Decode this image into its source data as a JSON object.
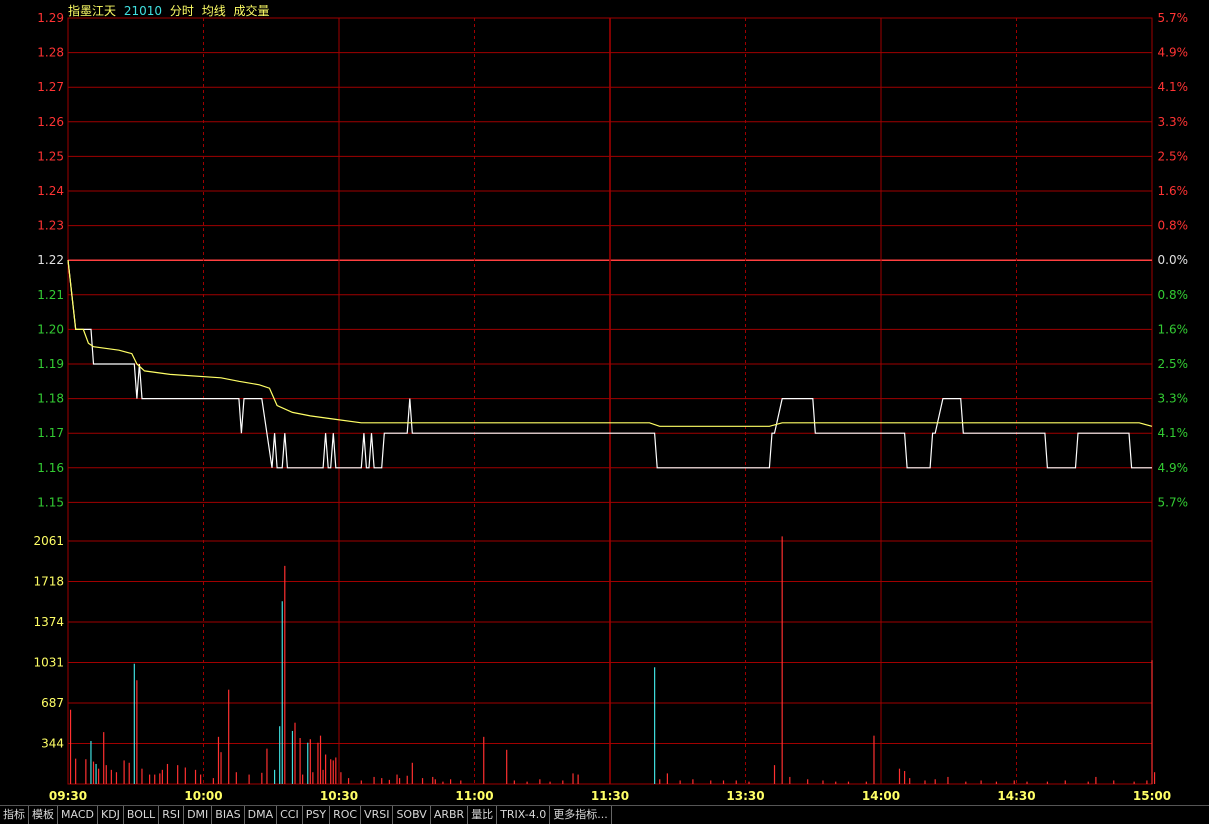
{
  "legend": {
    "name": "指墨江天",
    "code": "21010",
    "tabs": [
      "分时",
      "均线",
      "成交量"
    ]
  },
  "colors": {
    "grid": "#a00000",
    "up": "#ff3333",
    "down": "#33cc33",
    "neutral": "#e0e0e0",
    "price_line": "#ffffff",
    "avg_line": "#ffff66",
    "vol_up": "#ff3030",
    "vol_down": "#40e0e0",
    "volume_label": "#ffff66",
    "legend_name": "#ffff66",
    "legend_code": "#40e0e0",
    "legend_tabs": "#ffff66",
    "time_label": "#ffff66"
  },
  "indicator_tabs": [
    "指标",
    "模板",
    "MACD",
    "KDJ",
    "BOLL",
    "RSI",
    "DMI",
    "BIAS",
    "DMA",
    "CCI",
    "PSY",
    "ROC",
    "VRSI",
    "SOBV",
    "ARBR",
    "量比",
    "TRIX-4.0",
    "更多指标..."
  ],
  "chart_data": {
    "type": "line",
    "prev_close": 1.22,
    "price_axis": {
      "ticks": [
        "1.29",
        "1.28",
        "1.27",
        "1.26",
        "1.25",
        "1.24",
        "1.23",
        "1.22",
        "1.21",
        "1.20",
        "1.19",
        "1.18",
        "1.17",
        "1.16",
        "1.15"
      ],
      "ylim": [
        1.15,
        1.29
      ]
    },
    "pct_axis": {
      "ticks": [
        "5.7%",
        "4.9%",
        "4.1%",
        "3.3%",
        "2.5%",
        "1.6%",
        "0.8%",
        "0.0%",
        "0.8%",
        "1.6%",
        "2.5%",
        "3.3%",
        "4.1%",
        "4.9%",
        "5.7%"
      ]
    },
    "volume_axis": {
      "ticks": [
        "2061",
        "1718",
        "1374",
        "1031",
        "687",
        "344"
      ],
      "ylim": [
        0,
        2400
      ]
    },
    "time_axis": {
      "labels": [
        "09:30",
        "10:00",
        "10:30",
        "11:00",
        "11:30",
        "13:30",
        "14:00",
        "14:30",
        "15:00"
      ],
      "total_minutes": 240
    },
    "series": [
      {
        "name": "分时",
        "points": [
          [
            0,
            1.22
          ],
          [
            3,
            1.2
          ],
          [
            9,
            1.2
          ],
          [
            10,
            1.19
          ],
          [
            26,
            1.19
          ],
          [
            27,
            1.18
          ],
          [
            28,
            1.19
          ],
          [
            29,
            1.18
          ],
          [
            67,
            1.18
          ],
          [
            68,
            1.17
          ],
          [
            69,
            1.18
          ],
          [
            76,
            1.18
          ],
          [
            80,
            1.16
          ],
          [
            81,
            1.17
          ],
          [
            82,
            1.16
          ],
          [
            84,
            1.16
          ],
          [
            85,
            1.17
          ],
          [
            86,
            1.16
          ],
          [
            100,
            1.16
          ],
          [
            101,
            1.17
          ],
          [
            102,
            1.16
          ],
          [
            103,
            1.16
          ],
          [
            104,
            1.17
          ],
          [
            105,
            1.16
          ],
          [
            115,
            1.16
          ],
          [
            116,
            1.17
          ],
          [
            117,
            1.16
          ],
          [
            118,
            1.16
          ],
          [
            119,
            1.17
          ],
          [
            120,
            1.16
          ],
          [
            123,
            1.16
          ],
          [
            124,
            1.17
          ],
          [
            133,
            1.17
          ],
          [
            134,
            1.18
          ],
          [
            135,
            1.17
          ],
          [
            230,
            1.17
          ],
          [
            231,
            1.16
          ],
          [
            275,
            1.16
          ],
          [
            276,
            1.17
          ],
          [
            277,
            1.17
          ],
          [
            280,
            1.18
          ],
          [
            292,
            1.18
          ],
          [
            293,
            1.17
          ],
          [
            328,
            1.17
          ],
          [
            329,
            1.16
          ],
          [
            338,
            1.16
          ],
          [
            339,
            1.17
          ],
          [
            340,
            1.17
          ],
          [
            343,
            1.18
          ],
          [
            350,
            1.18
          ],
          [
            351,
            1.17
          ],
          [
            383,
            1.17
          ],
          [
            384,
            1.16
          ],
          [
            395,
            1.16
          ],
          [
            396,
            1.17
          ],
          [
            416,
            1.17
          ],
          [
            417,
            1.16
          ],
          [
            425,
            1.16
          ]
        ]
      },
      {
        "name": "均线",
        "points": [
          [
            0,
            1.22
          ],
          [
            3,
            1.2
          ],
          [
            6,
            1.2
          ],
          [
            8,
            1.196
          ],
          [
            10,
            1.195
          ],
          [
            20,
            1.194
          ],
          [
            25,
            1.193
          ],
          [
            27,
            1.19
          ],
          [
            30,
            1.188
          ],
          [
            40,
            1.187
          ],
          [
            60,
            1.186
          ],
          [
            67,
            1.185
          ],
          [
            75,
            1.184
          ],
          [
            79,
            1.183
          ],
          [
            82,
            1.178
          ],
          [
            88,
            1.176
          ],
          [
            95,
            1.175
          ],
          [
            105,
            1.174
          ],
          [
            115,
            1.173
          ],
          [
            125,
            1.173
          ],
          [
            150,
            1.173
          ],
          [
            200,
            1.173
          ],
          [
            228,
            1.173
          ],
          [
            232,
            1.172
          ],
          [
            275,
            1.172
          ],
          [
            280,
            1.173
          ],
          [
            330,
            1.173
          ],
          [
            380,
            1.173
          ],
          [
            420,
            1.173
          ],
          [
            425,
            1.172
          ]
        ]
      }
    ],
    "volumes": [
      [
        1,
        630,
        "up"
      ],
      [
        3,
        215,
        "up"
      ],
      [
        7,
        210,
        "up"
      ],
      [
        9,
        365,
        "down"
      ],
      [
        10,
        190,
        "up"
      ],
      [
        11,
        170,
        "down"
      ],
      [
        12,
        130,
        "up"
      ],
      [
        14,
        440,
        "up"
      ],
      [
        15,
        160,
        "up"
      ],
      [
        17,
        120,
        "up"
      ],
      [
        19,
        100,
        "up"
      ],
      [
        22,
        200,
        "up"
      ],
      [
        24,
        180,
        "up"
      ],
      [
        26,
        1020,
        "down"
      ],
      [
        27,
        880,
        "up"
      ],
      [
        29,
        130,
        "up"
      ],
      [
        32,
        80,
        "up"
      ],
      [
        34,
        80,
        "up"
      ],
      [
        36,
        90,
        "up"
      ],
      [
        37,
        120,
        "up"
      ],
      [
        39,
        170,
        "up"
      ],
      [
        43,
        160,
        "up"
      ],
      [
        46,
        140,
        "up"
      ],
      [
        50,
        120,
        "up"
      ],
      [
        52,
        80,
        "up"
      ],
      [
        57,
        50,
        "up"
      ],
      [
        59,
        400,
        "up"
      ],
      [
        60,
        270,
        "up"
      ],
      [
        63,
        800,
        "up"
      ],
      [
        66,
        100,
        "up"
      ],
      [
        71,
        80,
        "up"
      ],
      [
        76,
        95,
        "up"
      ],
      [
        78,
        300,
        "up"
      ],
      [
        81,
        120,
        "down"
      ],
      [
        83,
        490,
        "down"
      ],
      [
        84,
        1550,
        "down"
      ],
      [
        85,
        1850,
        "up"
      ],
      [
        88,
        450,
        "down"
      ],
      [
        89,
        520,
        "up"
      ],
      [
        91,
        390,
        "up"
      ],
      [
        92,
        80,
        "up"
      ],
      [
        94,
        350,
        "down"
      ],
      [
        95,
        380,
        "up"
      ],
      [
        96,
        100,
        "up"
      ],
      [
        98,
        350,
        "up"
      ],
      [
        99,
        410,
        "up"
      ],
      [
        100,
        120,
        "up"
      ],
      [
        101,
        250,
        "up"
      ],
      [
        103,
        210,
        "up"
      ],
      [
        104,
        200,
        "up"
      ],
      [
        105,
        225,
        "up"
      ],
      [
        107,
        100,
        "up"
      ],
      [
        110,
        50,
        "up"
      ],
      [
        115,
        30,
        "up"
      ],
      [
        120,
        60,
        "up"
      ],
      [
        123,
        50,
        "up"
      ],
      [
        126,
        35,
        "up"
      ],
      [
        129,
        80,
        "up"
      ],
      [
        130,
        50,
        "up"
      ],
      [
        133,
        70,
        "up"
      ],
      [
        135,
        180,
        "up"
      ],
      [
        139,
        50,
        "up"
      ],
      [
        143,
        60,
        "up"
      ],
      [
        144,
        40,
        "up"
      ],
      [
        147,
        20,
        "up"
      ],
      [
        150,
        40,
        "up"
      ],
      [
        154,
        30,
        "up"
      ],
      [
        163,
        400,
        "up"
      ],
      [
        172,
        290,
        "up"
      ],
      [
        175,
        30,
        "up"
      ],
      [
        180,
        20,
        "up"
      ],
      [
        185,
        40,
        "up"
      ],
      [
        189,
        20,
        "up"
      ],
      [
        194,
        30,
        "up"
      ],
      [
        198,
        90,
        "up"
      ],
      [
        200,
        80,
        "up"
      ],
      [
        230,
        990,
        "down"
      ],
      [
        232,
        40,
        "up"
      ],
      [
        235,
        90,
        "up"
      ],
      [
        240,
        30,
        "up"
      ],
      [
        245,
        40,
        "up"
      ],
      [
        252,
        30,
        "up"
      ],
      [
        257,
        30,
        "up"
      ],
      [
        262,
        30,
        "up"
      ],
      [
        267,
        20,
        "up"
      ],
      [
        277,
        160,
        "up"
      ],
      [
        280,
        2100,
        "up"
      ],
      [
        283,
        60,
        "up"
      ],
      [
        290,
        40,
        "up"
      ],
      [
        296,
        30,
        "up"
      ],
      [
        301,
        20,
        "up"
      ],
      [
        306,
        20,
        "up"
      ],
      [
        313,
        20,
        "up"
      ],
      [
        316,
        410,
        "up"
      ],
      [
        326,
        130,
        "up"
      ],
      [
        328,
        110,
        "up"
      ],
      [
        330,
        50,
        "up"
      ],
      [
        336,
        30,
        "up"
      ],
      [
        340,
        40,
        "up"
      ],
      [
        345,
        60,
        "up"
      ],
      [
        352,
        20,
        "up"
      ],
      [
        358,
        30,
        "up"
      ],
      [
        364,
        20,
        "up"
      ],
      [
        371,
        30,
        "up"
      ],
      [
        376,
        20,
        "up"
      ],
      [
        384,
        20,
        "up"
      ],
      [
        391,
        30,
        "up"
      ],
      [
        400,
        20,
        "up"
      ],
      [
        403,
        60,
        "up"
      ],
      [
        410,
        30,
        "up"
      ],
      [
        418,
        20,
        "up"
      ],
      [
        423,
        30,
        "up"
      ],
      [
        425,
        1050,
        "up"
      ],
      [
        426,
        100,
        "up"
      ]
    ]
  }
}
